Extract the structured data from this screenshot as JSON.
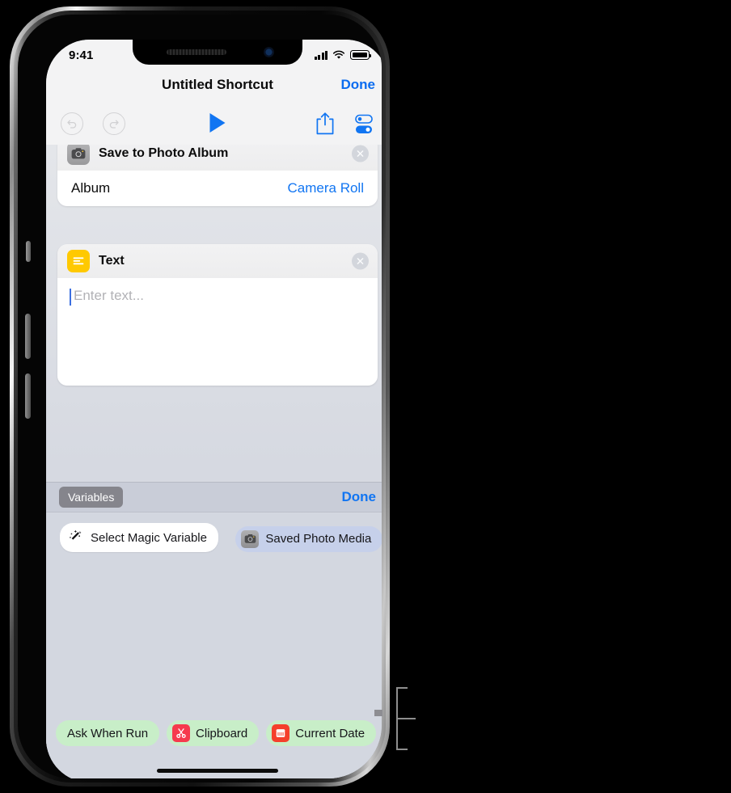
{
  "status_bar": {
    "time": "9:41",
    "cellular_icon": "cellular-signal-icon",
    "wifi_icon": "wifi-icon",
    "battery_icon": "battery-icon"
  },
  "nav_bar": {
    "title": "Untitled Shortcut",
    "done_label": "Done"
  },
  "toolbar": {
    "undo_icon": "undo-icon",
    "redo_icon": "redo-icon",
    "play_icon": "play-icon",
    "share_icon": "share-icon",
    "settings_icon": "settings-toggles-icon"
  },
  "actions": [
    {
      "icon": "camera-icon",
      "title": "Save to Photo Album",
      "close_icon": "close-circle-icon",
      "row_label": "Album",
      "row_value": "Camera Roll"
    },
    {
      "icon": "text-lines-icon",
      "title": "Text",
      "close_icon": "close-circle-icon",
      "placeholder": "Enter text...",
      "value": ""
    }
  ],
  "variables_bar": {
    "chip_label": "Variables",
    "done_label": "Done"
  },
  "variables_panel": {
    "magic_variable": {
      "icon": "magic-wand-icon",
      "label": "Select Magic Variable"
    },
    "saved_media": {
      "icon": "camera-icon",
      "label": "Saved Photo Media"
    }
  },
  "bottom_variable_chips": [
    {
      "label": "Ask When Run",
      "icon": null
    },
    {
      "label": "Clipboard",
      "icon": "scissors-icon"
    },
    {
      "label": "Current Date",
      "icon": "calendar-icon"
    }
  ],
  "colors": {
    "accent_blue": "#1175f2",
    "screen_bg": "#d3d7e0",
    "chip_green": "#c8eec8",
    "chip_blue": "#c6d0ea",
    "icon_yellow": "#ffc900",
    "icon_red": "#f63a4d"
  }
}
